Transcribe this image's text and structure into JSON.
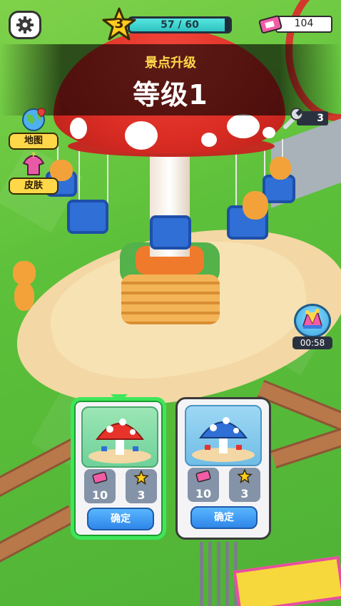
{
  "hud": {
    "level": "3",
    "xp_text": "57 / 60",
    "xp_progress": 0.95,
    "tickets": "104",
    "wrenches": "3"
  },
  "banner": {
    "subtitle": "景点升级",
    "title": "等级1"
  },
  "side_buttons": {
    "map_label": "地图",
    "skin_label": "皮肤"
  },
  "event": {
    "timer": "00:58"
  },
  "cards": [
    {
      "ticket_cost": "10",
      "star_cost": "3",
      "confirm_label": "确定",
      "selected": true,
      "color": "#e8332a"
    },
    {
      "ticket_cost": "10",
      "star_cost": "3",
      "confirm_label": "确定",
      "selected": false,
      "color": "#2f6fd6"
    }
  ],
  "colors": {
    "accent_green": "#3ee65a",
    "button_blue": "#2f86e8",
    "title_gold": "#ffd84a"
  }
}
